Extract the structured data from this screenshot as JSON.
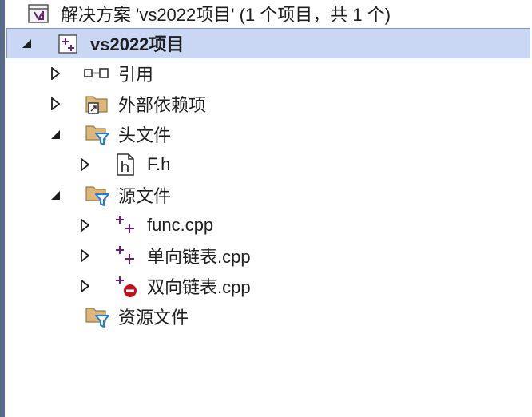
{
  "solution": {
    "label": "解决方案 'vs2022项目' (1 个项目，共 1 个)",
    "icon": "solution-icon"
  },
  "project": {
    "label": "vs2022项目",
    "icon": "cpp-project-icon",
    "expanded": true,
    "selected": true
  },
  "nodes": {
    "references": {
      "label": "引用",
      "icon": "references-icon",
      "expanded": false
    },
    "external": {
      "label": "外部依赖项",
      "icon": "external-dependencies-icon",
      "expanded": false
    },
    "headers": {
      "label": "头文件",
      "icon": "filter-folder-icon",
      "expanded": true
    },
    "header_file": {
      "label": "F.h",
      "icon": "header-file-icon",
      "expanded": false
    },
    "sources": {
      "label": "源文件",
      "icon": "filter-folder-icon",
      "expanded": true
    },
    "source_func": {
      "label": "func.cpp",
      "icon": "cpp-file-icon",
      "expanded": false
    },
    "source_single": {
      "label": "单向链表.cpp",
      "icon": "cpp-file-icon",
      "expanded": false
    },
    "source_double": {
      "label": "双向链表.cpp",
      "icon": "cpp-file-excluded-icon",
      "expanded": false
    },
    "resources": {
      "label": "资源文件",
      "icon": "filter-folder-icon"
    }
  },
  "colors": {
    "selection": "#c9d7f5",
    "selection_border": "#7f95c5",
    "vs_purple": "#68217a",
    "folder": "#dcb67a",
    "filter_blue": "#1f7bd8",
    "error_red": "#c50f1f"
  }
}
